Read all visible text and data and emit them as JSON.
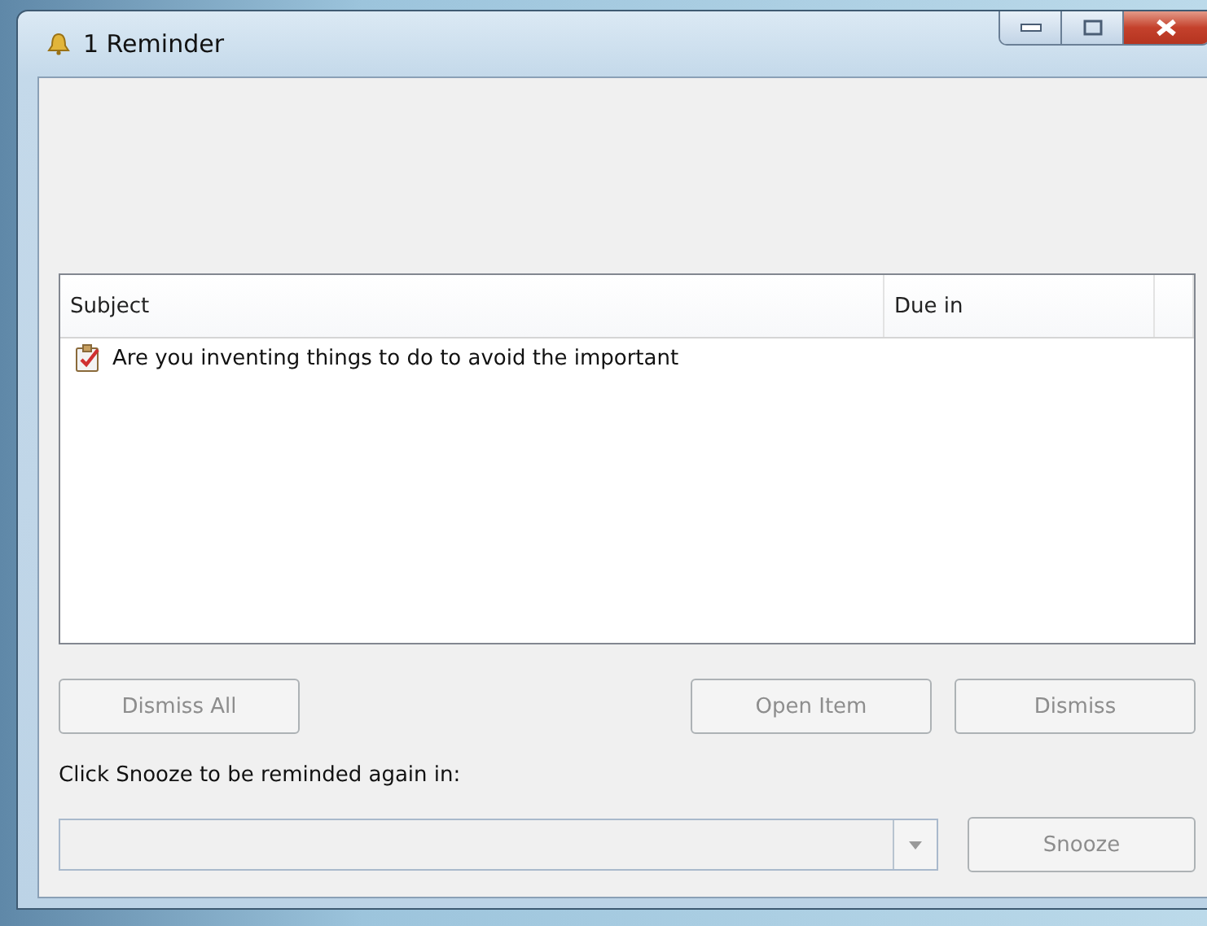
{
  "window": {
    "title": "1 Reminder"
  },
  "list": {
    "columns": [
      "Subject",
      "Due in"
    ],
    "rows": [
      {
        "subject": "Are you inventing things to do to avoid the important"
      }
    ]
  },
  "buttons": [
    {
      "label": "Dismiss All",
      "disabled": true
    },
    {
      "label": "Open Item",
      "disabled": true
    },
    {
      "label": "Dismiss",
      "disabled": true
    }
  ],
  "snooze": {
    "label": "Click Snooze to be reminded again in:",
    "disabled": true,
    "button": {
      "label": "Snooze",
      "disabled": true
    }
  }
}
